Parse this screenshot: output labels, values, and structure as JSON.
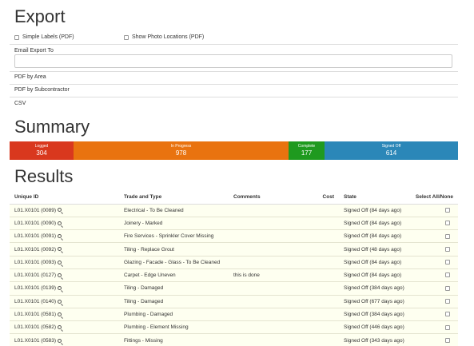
{
  "export": {
    "title": "Export",
    "simple_labels": "Simple Labels (PDF)",
    "show_photo_locations": "Show Photo Locations (PDF)",
    "email_label": "Email Export To",
    "email_value": "",
    "pdf_by_area": "PDF by Area",
    "pdf_by_subcontractor": "PDF by Subcontractor",
    "csv": "CSV"
  },
  "summary": {
    "title": "Summary",
    "segments": [
      {
        "label": "Logged",
        "count": "304",
        "color": "#d9381e"
      },
      {
        "label": "In Progress",
        "count": "978",
        "color": "#e9730f"
      },
      {
        "label": "Complete",
        "count": "177",
        "color": "#1f9a1f"
      },
      {
        "label": "Signed Off",
        "count": "614",
        "color": "#2b87b8"
      }
    ]
  },
  "results": {
    "title": "Results",
    "columns": [
      "Unique ID",
      "Trade and Type",
      "Comments",
      "Cost",
      "State",
      "Select All/None"
    ],
    "rows": [
      {
        "id": "L01.X0101 (0089)",
        "trade": "Electrical - To Be Cleaned",
        "comments": "",
        "cost": "",
        "state": "Signed Off (84 days ago)"
      },
      {
        "id": "L01.X0101 (0090)",
        "trade": "Joinery - Marked",
        "comments": "",
        "cost": "",
        "state": "Signed Off (84 days ago)"
      },
      {
        "id": "L01.X0101 (0091)",
        "trade": "Fire Services - Sprinkler Cover Missing",
        "comments": "",
        "cost": "",
        "state": "Signed Off (84 days ago)"
      },
      {
        "id": "L01.X0101 (0092)",
        "trade": "Tiling - Replace Grout",
        "comments": "",
        "cost": "",
        "state": "Signed Off (48 days ago)"
      },
      {
        "id": "L01.X0101 (0093)",
        "trade": "Glazing - Facade - Glass - To Be Cleaned",
        "comments": "",
        "cost": "",
        "state": "Signed Off (84 days ago)"
      },
      {
        "id": "L01.X0101 (0127)",
        "trade": "Carpet - Edge Uneven",
        "comments": "this is done",
        "cost": "",
        "state": "Signed Off (84 days ago)"
      },
      {
        "id": "L01.X0101 (0139)",
        "trade": "Tiling - Damaged",
        "comments": "",
        "cost": "",
        "state": "Signed Off (384 days ago)"
      },
      {
        "id": "L01.X0101 (0140)",
        "trade": "Tiling - Damaged",
        "comments": "",
        "cost": "",
        "state": "Signed Off (677 days ago)"
      },
      {
        "id": "L01.X0101 (0581)",
        "trade": "Plumbing - Damaged",
        "comments": "",
        "cost": "",
        "state": "Signed Off (384 days ago)"
      },
      {
        "id": "L01.X0101 (0582)",
        "trade": "Plumbing - Element Missing",
        "comments": "",
        "cost": "",
        "state": "Signed Off (446 days ago)"
      },
      {
        "id": "L01.X0101 (0583)",
        "trade": "Fittings - Missing",
        "comments": "",
        "cost": "",
        "state": "Signed Off (343 days ago)"
      }
    ]
  }
}
